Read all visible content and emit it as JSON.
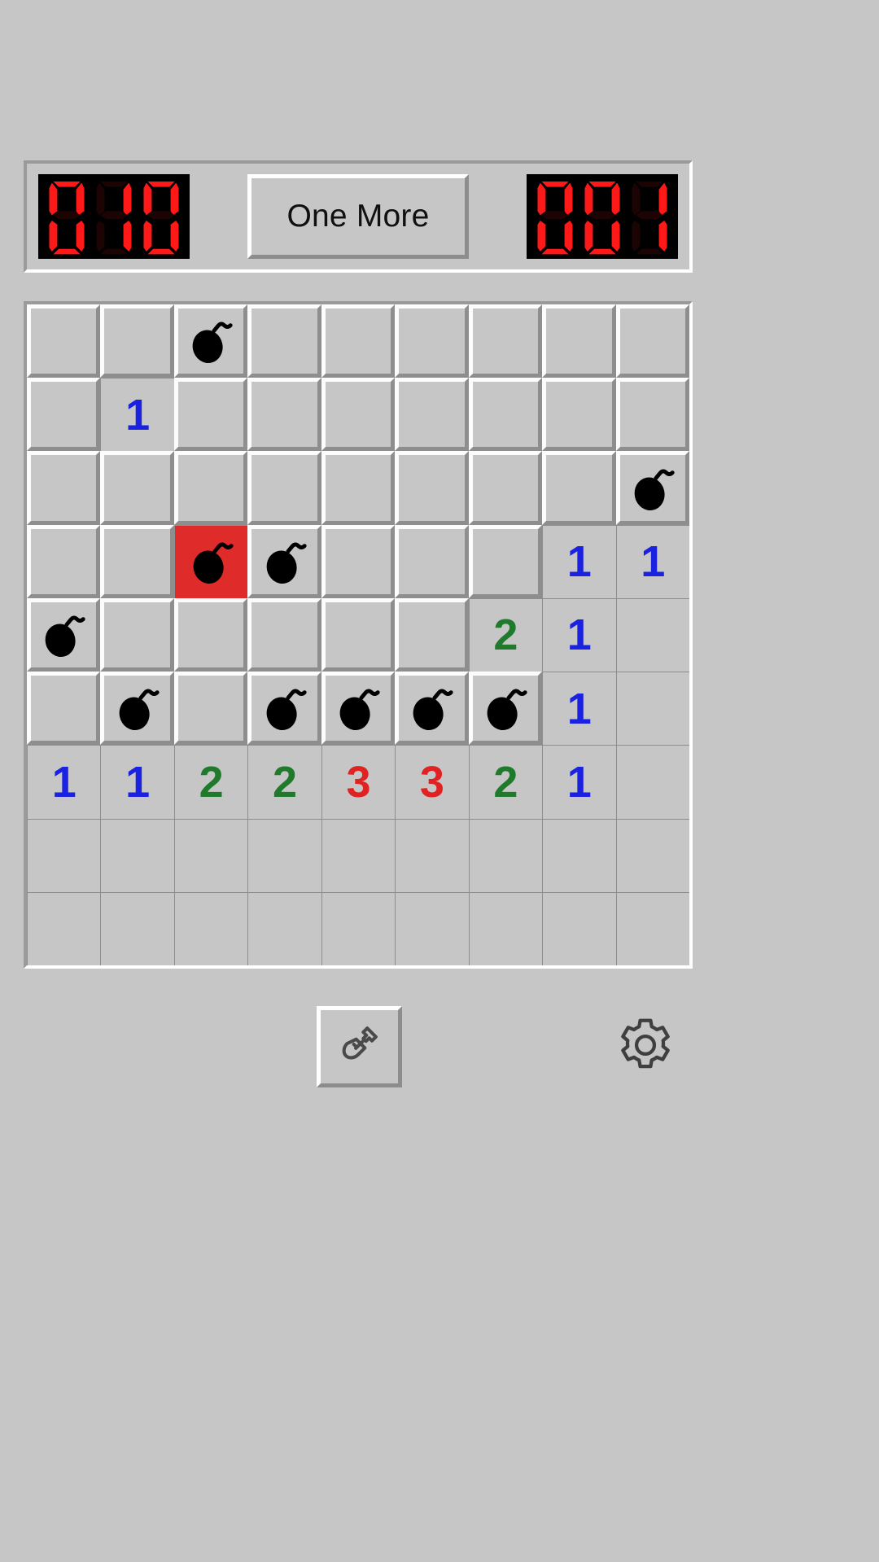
{
  "app": {
    "title": "Minesweeper",
    "background_color": "#c6c6c6"
  },
  "header": {
    "mine_counter": {
      "name": "mines-remaining",
      "value": "010",
      "digits": [
        0,
        1,
        0
      ],
      "segment_color": "#fe1919",
      "segment_off_color": "#1d0404",
      "background_color": "#000000"
    },
    "new_game_button": {
      "label": "One More"
    },
    "timer": {
      "name": "elapsed-timer",
      "value": "001",
      "digits": [
        0,
        0,
        1
      ],
      "segment_color": "#fe1919",
      "segment_off_color": "#1d0404",
      "background_color": "#000000"
    }
  },
  "board": {
    "columns": 9,
    "rows": 9,
    "number_colors": {
      "1": "#1b21e0",
      "2": "#1f7a2b",
      "3": "#e02222"
    },
    "exploded_color": "#e02b2b",
    "bomb_icon": "bomb-icon",
    "cells": [
      [
        {
          "state": "covered",
          "content": ""
        },
        {
          "state": "covered",
          "content": ""
        },
        {
          "state": "covered",
          "content": "bomb"
        },
        {
          "state": "covered",
          "content": ""
        },
        {
          "state": "covered",
          "content": ""
        },
        {
          "state": "covered",
          "content": ""
        },
        {
          "state": "covered",
          "content": ""
        },
        {
          "state": "covered",
          "content": ""
        },
        {
          "state": "covered",
          "content": ""
        }
      ],
      [
        {
          "state": "covered",
          "content": ""
        },
        {
          "state": "revealed",
          "content": "1"
        },
        {
          "state": "covered",
          "content": ""
        },
        {
          "state": "covered",
          "content": ""
        },
        {
          "state": "covered",
          "content": ""
        },
        {
          "state": "covered",
          "content": ""
        },
        {
          "state": "covered",
          "content": ""
        },
        {
          "state": "covered",
          "content": ""
        },
        {
          "state": "covered",
          "content": ""
        }
      ],
      [
        {
          "state": "covered",
          "content": ""
        },
        {
          "state": "covered",
          "content": ""
        },
        {
          "state": "covered",
          "content": ""
        },
        {
          "state": "covered",
          "content": ""
        },
        {
          "state": "covered",
          "content": ""
        },
        {
          "state": "covered",
          "content": ""
        },
        {
          "state": "covered",
          "content": ""
        },
        {
          "state": "covered",
          "content": ""
        },
        {
          "state": "covered",
          "content": "bomb"
        }
      ],
      [
        {
          "state": "covered",
          "content": ""
        },
        {
          "state": "covered",
          "content": ""
        },
        {
          "state": "revealed",
          "content": "bomb",
          "exploded": true
        },
        {
          "state": "covered",
          "content": "bomb"
        },
        {
          "state": "covered",
          "content": ""
        },
        {
          "state": "covered",
          "content": ""
        },
        {
          "state": "covered",
          "content": ""
        },
        {
          "state": "revealed",
          "content": "1"
        },
        {
          "state": "revealed",
          "content": "1"
        }
      ],
      [
        {
          "state": "covered",
          "content": "bomb"
        },
        {
          "state": "covered",
          "content": ""
        },
        {
          "state": "covered",
          "content": ""
        },
        {
          "state": "covered",
          "content": ""
        },
        {
          "state": "covered",
          "content": ""
        },
        {
          "state": "covered",
          "content": ""
        },
        {
          "state": "revealed",
          "content": "2"
        },
        {
          "state": "revealed",
          "content": "1"
        },
        {
          "state": "revealed",
          "content": ""
        }
      ],
      [
        {
          "state": "covered",
          "content": ""
        },
        {
          "state": "covered",
          "content": "bomb"
        },
        {
          "state": "covered",
          "content": ""
        },
        {
          "state": "covered",
          "content": "bomb"
        },
        {
          "state": "covered",
          "content": "bomb"
        },
        {
          "state": "covered",
          "content": "bomb"
        },
        {
          "state": "covered",
          "content": "bomb"
        },
        {
          "state": "revealed",
          "content": "1"
        },
        {
          "state": "revealed",
          "content": ""
        }
      ],
      [
        {
          "state": "revealed",
          "content": "1"
        },
        {
          "state": "revealed",
          "content": "1"
        },
        {
          "state": "revealed",
          "content": "2"
        },
        {
          "state": "revealed",
          "content": "2"
        },
        {
          "state": "revealed",
          "content": "3"
        },
        {
          "state": "revealed",
          "content": "3"
        },
        {
          "state": "revealed",
          "content": "2"
        },
        {
          "state": "revealed",
          "content": "1"
        },
        {
          "state": "revealed",
          "content": ""
        }
      ],
      [
        {
          "state": "revealed",
          "content": ""
        },
        {
          "state": "revealed",
          "content": ""
        },
        {
          "state": "revealed",
          "content": ""
        },
        {
          "state": "revealed",
          "content": ""
        },
        {
          "state": "revealed",
          "content": ""
        },
        {
          "state": "revealed",
          "content": ""
        },
        {
          "state": "revealed",
          "content": ""
        },
        {
          "state": "revealed",
          "content": ""
        },
        {
          "state": "revealed",
          "content": ""
        }
      ],
      [
        {
          "state": "revealed",
          "content": ""
        },
        {
          "state": "revealed",
          "content": ""
        },
        {
          "state": "revealed",
          "content": ""
        },
        {
          "state": "revealed",
          "content": ""
        },
        {
          "state": "revealed",
          "content": ""
        },
        {
          "state": "revealed",
          "content": ""
        },
        {
          "state": "revealed",
          "content": ""
        },
        {
          "state": "revealed",
          "content": ""
        },
        {
          "state": "revealed",
          "content": ""
        }
      ]
    ]
  },
  "toolbar": {
    "dig_mode_button": {
      "icon": "shovel-icon",
      "active": true
    },
    "settings_button": {
      "icon": "gear-icon"
    }
  }
}
